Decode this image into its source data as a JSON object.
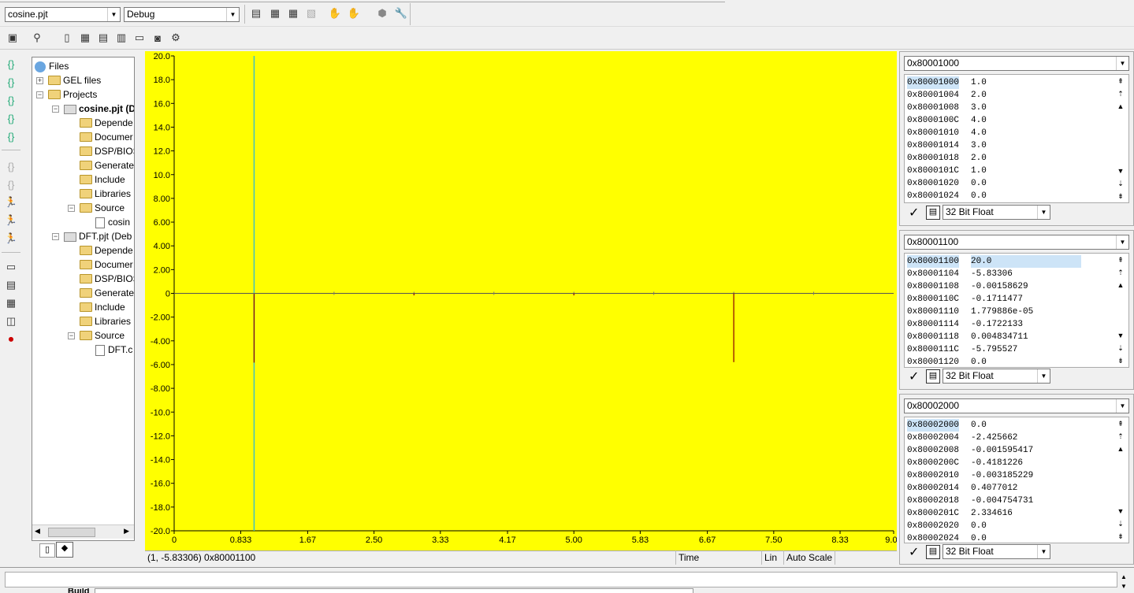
{
  "toolbar": {
    "project_combo": "cosine.pjt",
    "config_combo": "Debug"
  },
  "tree": {
    "root": "Files",
    "items": [
      {
        "label": "GEL files"
      },
      {
        "label": "Projects"
      },
      {
        "label": "cosine.pjt (D"
      },
      {
        "label": "Depende"
      },
      {
        "label": "Documer"
      },
      {
        "label": "DSP/BIOS"
      },
      {
        "label": "Generate"
      },
      {
        "label": "Include"
      },
      {
        "label": "Libraries"
      },
      {
        "label": "Source"
      },
      {
        "label": "cosin"
      },
      {
        "label": "DFT.pjt (Deb"
      },
      {
        "label": "Depende"
      },
      {
        "label": "Documer"
      },
      {
        "label": "DSP/BIOS"
      },
      {
        "label": "Generate"
      },
      {
        "label": "Include"
      },
      {
        "label": "Libraries"
      },
      {
        "label": "Source"
      },
      {
        "label": "DFT.c"
      }
    ]
  },
  "graph": {
    "bg_color": "#ffff00",
    "y_ticks": [
      "20.0",
      "18.0",
      "16.0",
      "14.0",
      "12.0",
      "10.0",
      "8.00",
      "6.00",
      "4.00",
      "2.00",
      "0",
      "-2.00",
      "-4.00",
      "-6.00",
      "-8.00",
      "-10.0",
      "-12.0",
      "-14.0",
      "-16.0",
      "-18.0",
      "-20.0"
    ],
    "x_ticks": [
      "0",
      "0.833",
      "1.67",
      "2.50",
      "3.33",
      "4.17",
      "5.00",
      "5.83",
      "6.67",
      "7.50",
      "8.33",
      "9.00"
    ],
    "status": {
      "cursor": "(1, -5.83306)  0x80001100",
      "axis": "Time",
      "scale": "Lin",
      "mode": "Auto Scale"
    }
  },
  "chart_data": {
    "type": "line",
    "x": [
      0,
      1,
      2,
      3,
      4,
      5,
      6,
      7,
      8,
      9
    ],
    "y": [
      20.0,
      -5.83306,
      -0.00158629,
      -0.1711477,
      1.779886e-05,
      -0.1722133,
      0.004834711,
      -5.795527,
      0.0,
      0.0
    ],
    "xlim": [
      0,
      9.0
    ],
    "ylim": [
      -20.0,
      20.0
    ],
    "line_color": "#8b0000",
    "cursor_x": 1
  },
  "memory": [
    {
      "address_combo": "0x80001000",
      "rows": [
        {
          "addr": "0x80001000",
          "val": "1.0"
        },
        {
          "addr": "0x80001004",
          "val": "2.0"
        },
        {
          "addr": "0x80001008",
          "val": "3.0"
        },
        {
          "addr": "0x8000100C",
          "val": "4.0"
        },
        {
          "addr": "0x80001010",
          "val": "4.0"
        },
        {
          "addr": "0x80001014",
          "val": "3.0"
        },
        {
          "addr": "0x80001018",
          "val": "2.0"
        },
        {
          "addr": "0x8000101C",
          "val": "1.0"
        },
        {
          "addr": "0x80001020",
          "val": "0.0"
        },
        {
          "addr": "0x80001024",
          "val": "0.0"
        }
      ],
      "format": "32 Bit Float"
    },
    {
      "address_combo": "0x80001100",
      "rows": [
        {
          "addr": "0x80001100",
          "val": "20.0"
        },
        {
          "addr": "0x80001104",
          "val": "-5.83306"
        },
        {
          "addr": "0x80001108",
          "val": "-0.00158629"
        },
        {
          "addr": "0x8000110C",
          "val": "-0.1711477"
        },
        {
          "addr": "0x80001110",
          "val": "1.779886e-05"
        },
        {
          "addr": "0x80001114",
          "val": "-0.1722133"
        },
        {
          "addr": "0x80001118",
          "val": "0.004834711"
        },
        {
          "addr": "0x8000111C",
          "val": "-5.795527"
        },
        {
          "addr": "0x80001120",
          "val": "0.0"
        }
      ],
      "format": "32 Bit Float"
    },
    {
      "address_combo": "0x80002000",
      "rows": [
        {
          "addr": "0x80002000",
          "val": "0.0"
        },
        {
          "addr": "0x80002004",
          "val": "-2.425662"
        },
        {
          "addr": "0x80002008",
          "val": "-0.001595417"
        },
        {
          "addr": "0x8000200C",
          "val": "-0.4181226"
        },
        {
          "addr": "0x80002010",
          "val": "-0.003185229"
        },
        {
          "addr": "0x80002014",
          "val": "0.4077012"
        },
        {
          "addr": "0x80002018",
          "val": "-0.004754731"
        },
        {
          "addr": "0x8000201C",
          "val": "2.334616"
        },
        {
          "addr": "0x80002020",
          "val": "0.0"
        },
        {
          "addr": "0x80002024",
          "val": "0.0"
        }
      ],
      "format": "32 Bit Float"
    }
  ],
  "bottom": {
    "tab_label": "Build"
  }
}
